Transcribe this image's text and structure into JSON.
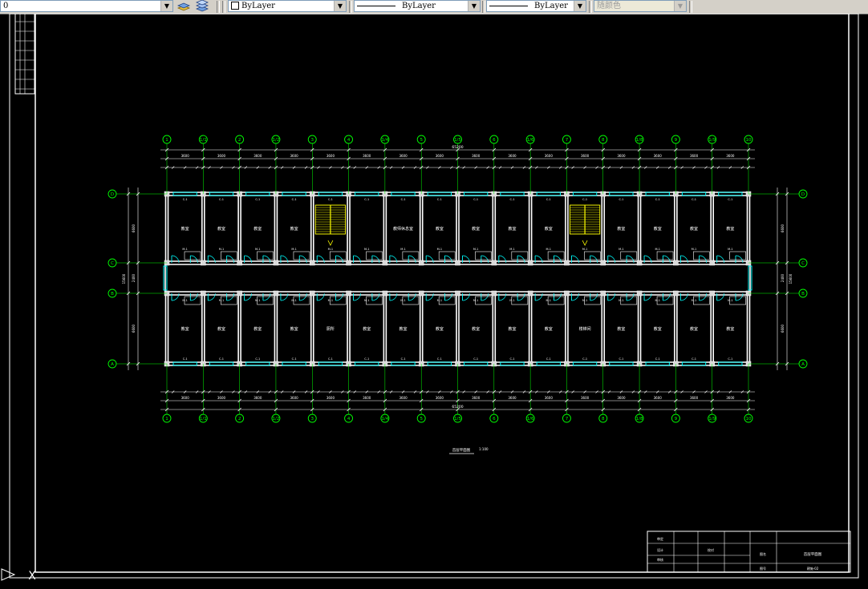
{
  "toolbar": {
    "layer_value": "0",
    "color_value": "ByLayer",
    "linetype_value": "ByLayer",
    "lineweight_value": "ByLayer",
    "plotstyle_value": "随颜色"
  },
  "drawing": {
    "colors": {
      "background": "#000000",
      "grid": "#00ff00",
      "walls": "#ffffff",
      "doors": "#00ffff",
      "stairs": "#ffff00",
      "text": "#ffffff"
    },
    "top_overall_dim": "65200",
    "bottom_overall_dim": "65200",
    "top_bays": [
      "3600",
      "3600",
      "3600",
      "3600",
      "3600",
      "3600",
      "3600",
      "3600",
      "3600",
      "3600",
      "3600",
      "3600",
      "3600",
      "3600",
      "3600",
      "3600"
    ],
    "bottom_bays": [
      "3600",
      "3600",
      "3600",
      "3600",
      "3600",
      "3600",
      "3600",
      "3600",
      "3600",
      "3600",
      "3600",
      "3600",
      "3600",
      "3600",
      "3600",
      "3600"
    ],
    "grid_columns": [
      "1",
      "1/1",
      "2",
      "1/2",
      "3",
      "4",
      "1/4",
      "5",
      "1/5",
      "6",
      "1/6",
      "7",
      "8",
      "1/8",
      "9",
      "1/9",
      "10"
    ],
    "grid_rows": [
      "D",
      "C",
      "B",
      "A"
    ],
    "left_dims": [
      "6600",
      "2400",
      "6600"
    ],
    "left_total": "15600",
    "right_dims": [
      "6600",
      "2400",
      "6600"
    ],
    "right_total": "15600",
    "top_rooms": [
      "教室",
      "教室",
      "教室",
      "教室",
      "",
      "",
      "教师休息室",
      "教室",
      "教室",
      "教室",
      "教室",
      "",
      "教室",
      "教室",
      "教室",
      "教室"
    ],
    "bottom_rooms": [
      "教室",
      "教室",
      "教室",
      "教室",
      "厕所",
      "教室",
      "教室",
      "教室",
      "教室",
      "教室",
      "教室",
      "楼梯间",
      "教室",
      "教室",
      "教室",
      "教室"
    ],
    "plan_title": "首层平面图",
    "plan_scale": "1:100"
  },
  "title_block": {
    "cells": [
      "审定",
      "设计",
      "审核",
      "校对",
      "图名",
      "图号",
      "建施-02"
    ],
    "drawing_name": "首层平面图"
  },
  "ucs_icon_label": "X"
}
